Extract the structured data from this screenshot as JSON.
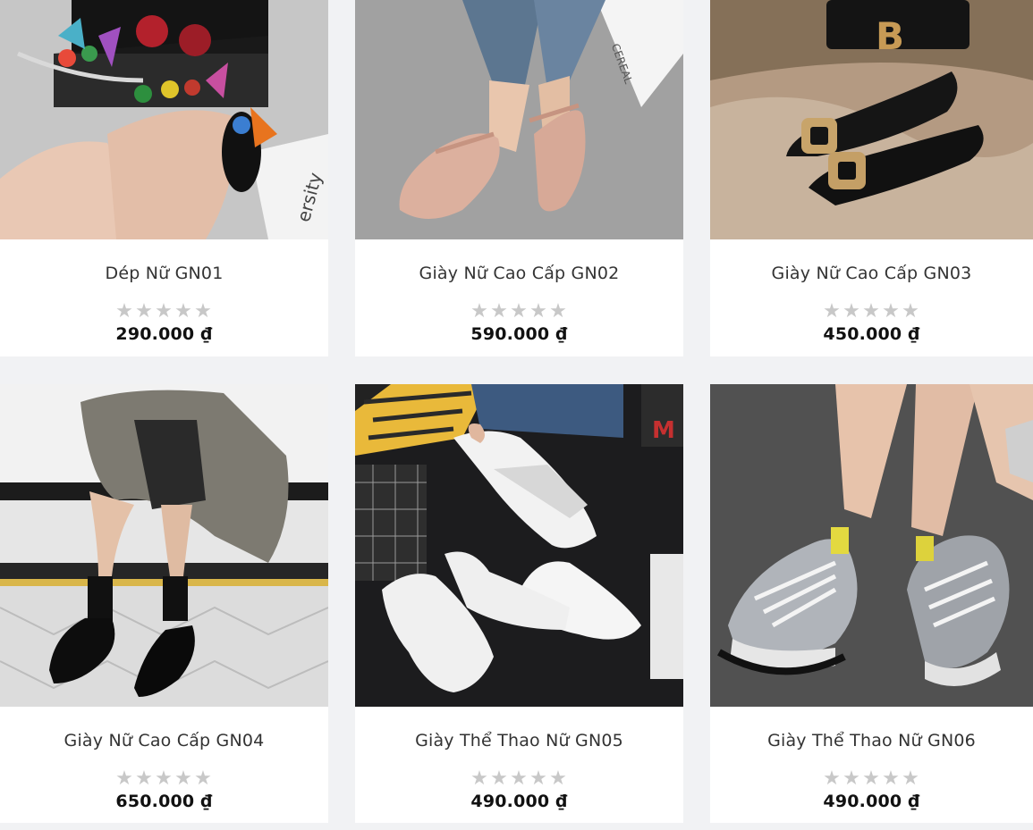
{
  "products": [
    {
      "name": "Dép Nữ GN01",
      "price": "290.000 ₫",
      "rating": 0,
      "image": "sandals-with-pompom-tassels"
    },
    {
      "name": "Giày Nữ Cao Cấp GN02",
      "price": "590.000 ₫",
      "rating": 0,
      "image": "nude-mary-jane-flats"
    },
    {
      "name": "Giày Nữ Cao Cấp GN03",
      "price": "450.000 ₫",
      "rating": 0,
      "image": "black-pointed-flats-gold-buckle"
    },
    {
      "name": "Giày Nữ Cao Cấp GN04",
      "price": "650.000 ₫",
      "rating": 0,
      "image": "black-patent-oxford-shoes"
    },
    {
      "name": "Giày Thể Thao Nữ GN05",
      "price": "490.000 ₫",
      "rating": 0,
      "image": "white-chunky-sneakers"
    },
    {
      "name": "Giày Thể Thao Nữ GN06",
      "price": "490.000 ₫",
      "rating": 0,
      "image": "grey-chunky-sneakers"
    }
  ],
  "stars_glyph": "★★★★★",
  "colors": {
    "page_bg": "#f1f2f4",
    "card_bg": "#ffffff",
    "star_empty": "#c8c8c8",
    "price": "#111111"
  }
}
